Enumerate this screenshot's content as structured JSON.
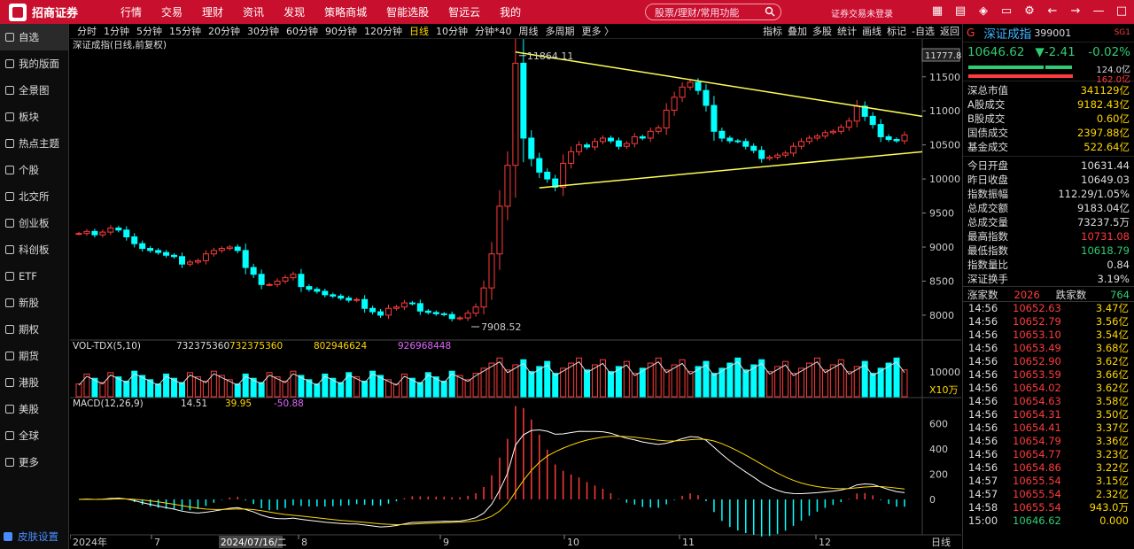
{
  "app": {
    "logo_text": "招商证券",
    "menu": [
      "行情",
      "交易",
      "理财",
      "资讯",
      "发现",
      "策略商城",
      "智能选股",
      "智远云",
      "我的"
    ],
    "search_placeholder": "股票/理财/常用功能",
    "account_status": "证券交易未登录",
    "colors": {
      "red": "#c8102e",
      "up": "#ff3b3b",
      "down": "#00ffff",
      "accent": "#ffd700"
    }
  },
  "sidebar": {
    "items": [
      "自选",
      "我的版面",
      "全景图",
      "板块",
      "热点主题",
      "个股",
      "北交所",
      "创业板",
      "科创板",
      "ETF",
      "新股",
      "期权",
      "期货",
      "港股",
      "美股",
      "全球",
      "更多"
    ],
    "active": 0,
    "skin": "皮肤设置"
  },
  "toolbar": {
    "periods": [
      "分时",
      "1分钟",
      "5分钟",
      "15分钟",
      "20分钟",
      "30分钟",
      "60分钟",
      "90分钟",
      "120分钟",
      "日线",
      "10分钟",
      "分钟*40",
      "周线",
      "多周期",
      "更多 〉"
    ],
    "active_period": "日线",
    "tools": [
      "指标",
      "叠加",
      "多股",
      "统计",
      "画线",
      "标记",
      "-自选",
      "返回"
    ]
  },
  "chart_data": {
    "type": "candlestick",
    "title": "深证成指(日线,前复权)",
    "y_ticks": [
      8000,
      8500,
      9000,
      9500,
      10000,
      10500,
      11000,
      11500
    ],
    "ylim": [
      7700,
      11900
    ],
    "current_price_label": "11777.8",
    "annotations": {
      "high": "11864.11",
      "low": "7908.52"
    },
    "x_ticks": [
      "2024年",
      "7",
      "8",
      "9",
      "10",
      "11",
      "12",
      "日线"
    ],
    "cursor_date": "2024/07/16/二",
    "triangle_upper": [
      [
        10,
        11864
      ],
      [
        29,
        10920
      ]
    ],
    "triangle_lower": [
      [
        9,
        9870
      ],
      [
        29,
        10400
      ]
    ],
    "closes": [
      9200,
      9230,
      9180,
      9220,
      9280,
      9250,
      9150,
      9050,
      8980,
      8950,
      8920,
      8880,
      8860,
      8750,
      8780,
      8800,
      8900,
      8950,
      8980,
      9000,
      8950,
      8700,
      8600,
      8450,
      8450,
      8500,
      8550,
      8600,
      8420,
      8380,
      8350,
      8300,
      8280,
      8250,
      8220,
      8230,
      8100,
      8050,
      8000,
      8100,
      8120,
      8180,
      8170,
      8060,
      8040,
      8020,
      8010,
      7950,
      7960,
      8030,
      8120,
      8400,
      8900,
      9600,
      10200,
      11700,
      10600,
      10300,
      10100,
      10000,
      9880,
      10230,
      10400,
      10500,
      10470,
      10550,
      10600,
      10560,
      10480,
      10520,
      10620,
      10600,
      10700,
      10750,
      11010,
      11200,
      11350,
      11420,
      11300,
      11080,
      10700,
      10600,
      10560,
      10550,
      10480,
      10420,
      10300,
      10320,
      10350,
      10380,
      10480,
      10550,
      10600,
      10630,
      10680,
      10700,
      10760,
      10850,
      11070,
      10920,
      10800,
      10620,
      10580,
      10560,
      10646
    ],
    "volume": {
      "label": "VOL-TDX(5,10)",
      "vvol": "732375360",
      "volume": "732375360",
      "ma5": "802946624",
      "ma10": "926968448",
      "unit_label": "X10万",
      "y_ticks": [
        10000
      ]
    },
    "macd": {
      "label": "MACD(12,26,9)",
      "dif": "14.51",
      "dea": "39.95",
      "macd": "-50.88",
      "y_ticks": [
        600,
        400,
        200,
        0
      ]
    }
  },
  "right": {
    "market": "G",
    "name": "深证成指",
    "code": "399001",
    "tag": "SG1",
    "price": "10646.62",
    "change": "▼-2.41",
    "pct": "-0.02%",
    "bar_vals": [
      "124.0亿",
      "162.0亿"
    ],
    "rows1": [
      [
        "深总市值",
        "341129亿"
      ],
      [
        "A股成交",
        "9182.43亿"
      ],
      [
        "B股成交",
        "0.60亿"
      ],
      [
        "国债成交",
        "2397.88亿"
      ],
      [
        "基金成交",
        "522.64亿"
      ]
    ],
    "rows2": [
      [
        "今日开盘",
        "10631.44"
      ],
      [
        "昨日收盘",
        "10649.03"
      ],
      [
        "指数振幅",
        "112.29/1.05%"
      ],
      [
        "总成交额",
        "9183.04亿"
      ],
      [
        "总成交量",
        "73237.5万"
      ],
      [
        "最高指数",
        "10731.08"
      ],
      [
        "最低指数",
        "10618.79"
      ],
      [
        "指数量比",
        "0.84"
      ],
      [
        "深证换手",
        "3.19%"
      ]
    ],
    "updown": {
      "up_label": "涨家数",
      "up": "2026",
      "down_label": "跌家数",
      "down": "764"
    },
    "ticks": [
      [
        "14:56",
        "10652.63",
        "3.47亿"
      ],
      [
        "14:56",
        "10652.79",
        "3.56亿"
      ],
      [
        "14:56",
        "10653.10",
        "3.54亿"
      ],
      [
        "14:56",
        "10653.49",
        "3.68亿"
      ],
      [
        "14:56",
        "10652.90",
        "3.62亿"
      ],
      [
        "14:56",
        "10653.59",
        "3.66亿"
      ],
      [
        "14:56",
        "10654.02",
        "3.62亿"
      ],
      [
        "14:56",
        "10654.63",
        "3.58亿"
      ],
      [
        "14:56",
        "10654.31",
        "3.50亿"
      ],
      [
        "14:56",
        "10654.41",
        "3.37亿"
      ],
      [
        "14:56",
        "10654.79",
        "3.36亿"
      ],
      [
        "14:56",
        "10654.77",
        "3.23亿"
      ],
      [
        "14:56",
        "10654.86",
        "3.22亿"
      ],
      [
        "14:57",
        "10655.54",
        "3.15亿"
      ],
      [
        "14:57",
        "10655.54",
        "2.32亿"
      ],
      [
        "14:58",
        "10655.54",
        "943.0万"
      ],
      [
        "15:00",
        "10646.62",
        "0.000"
      ]
    ]
  }
}
